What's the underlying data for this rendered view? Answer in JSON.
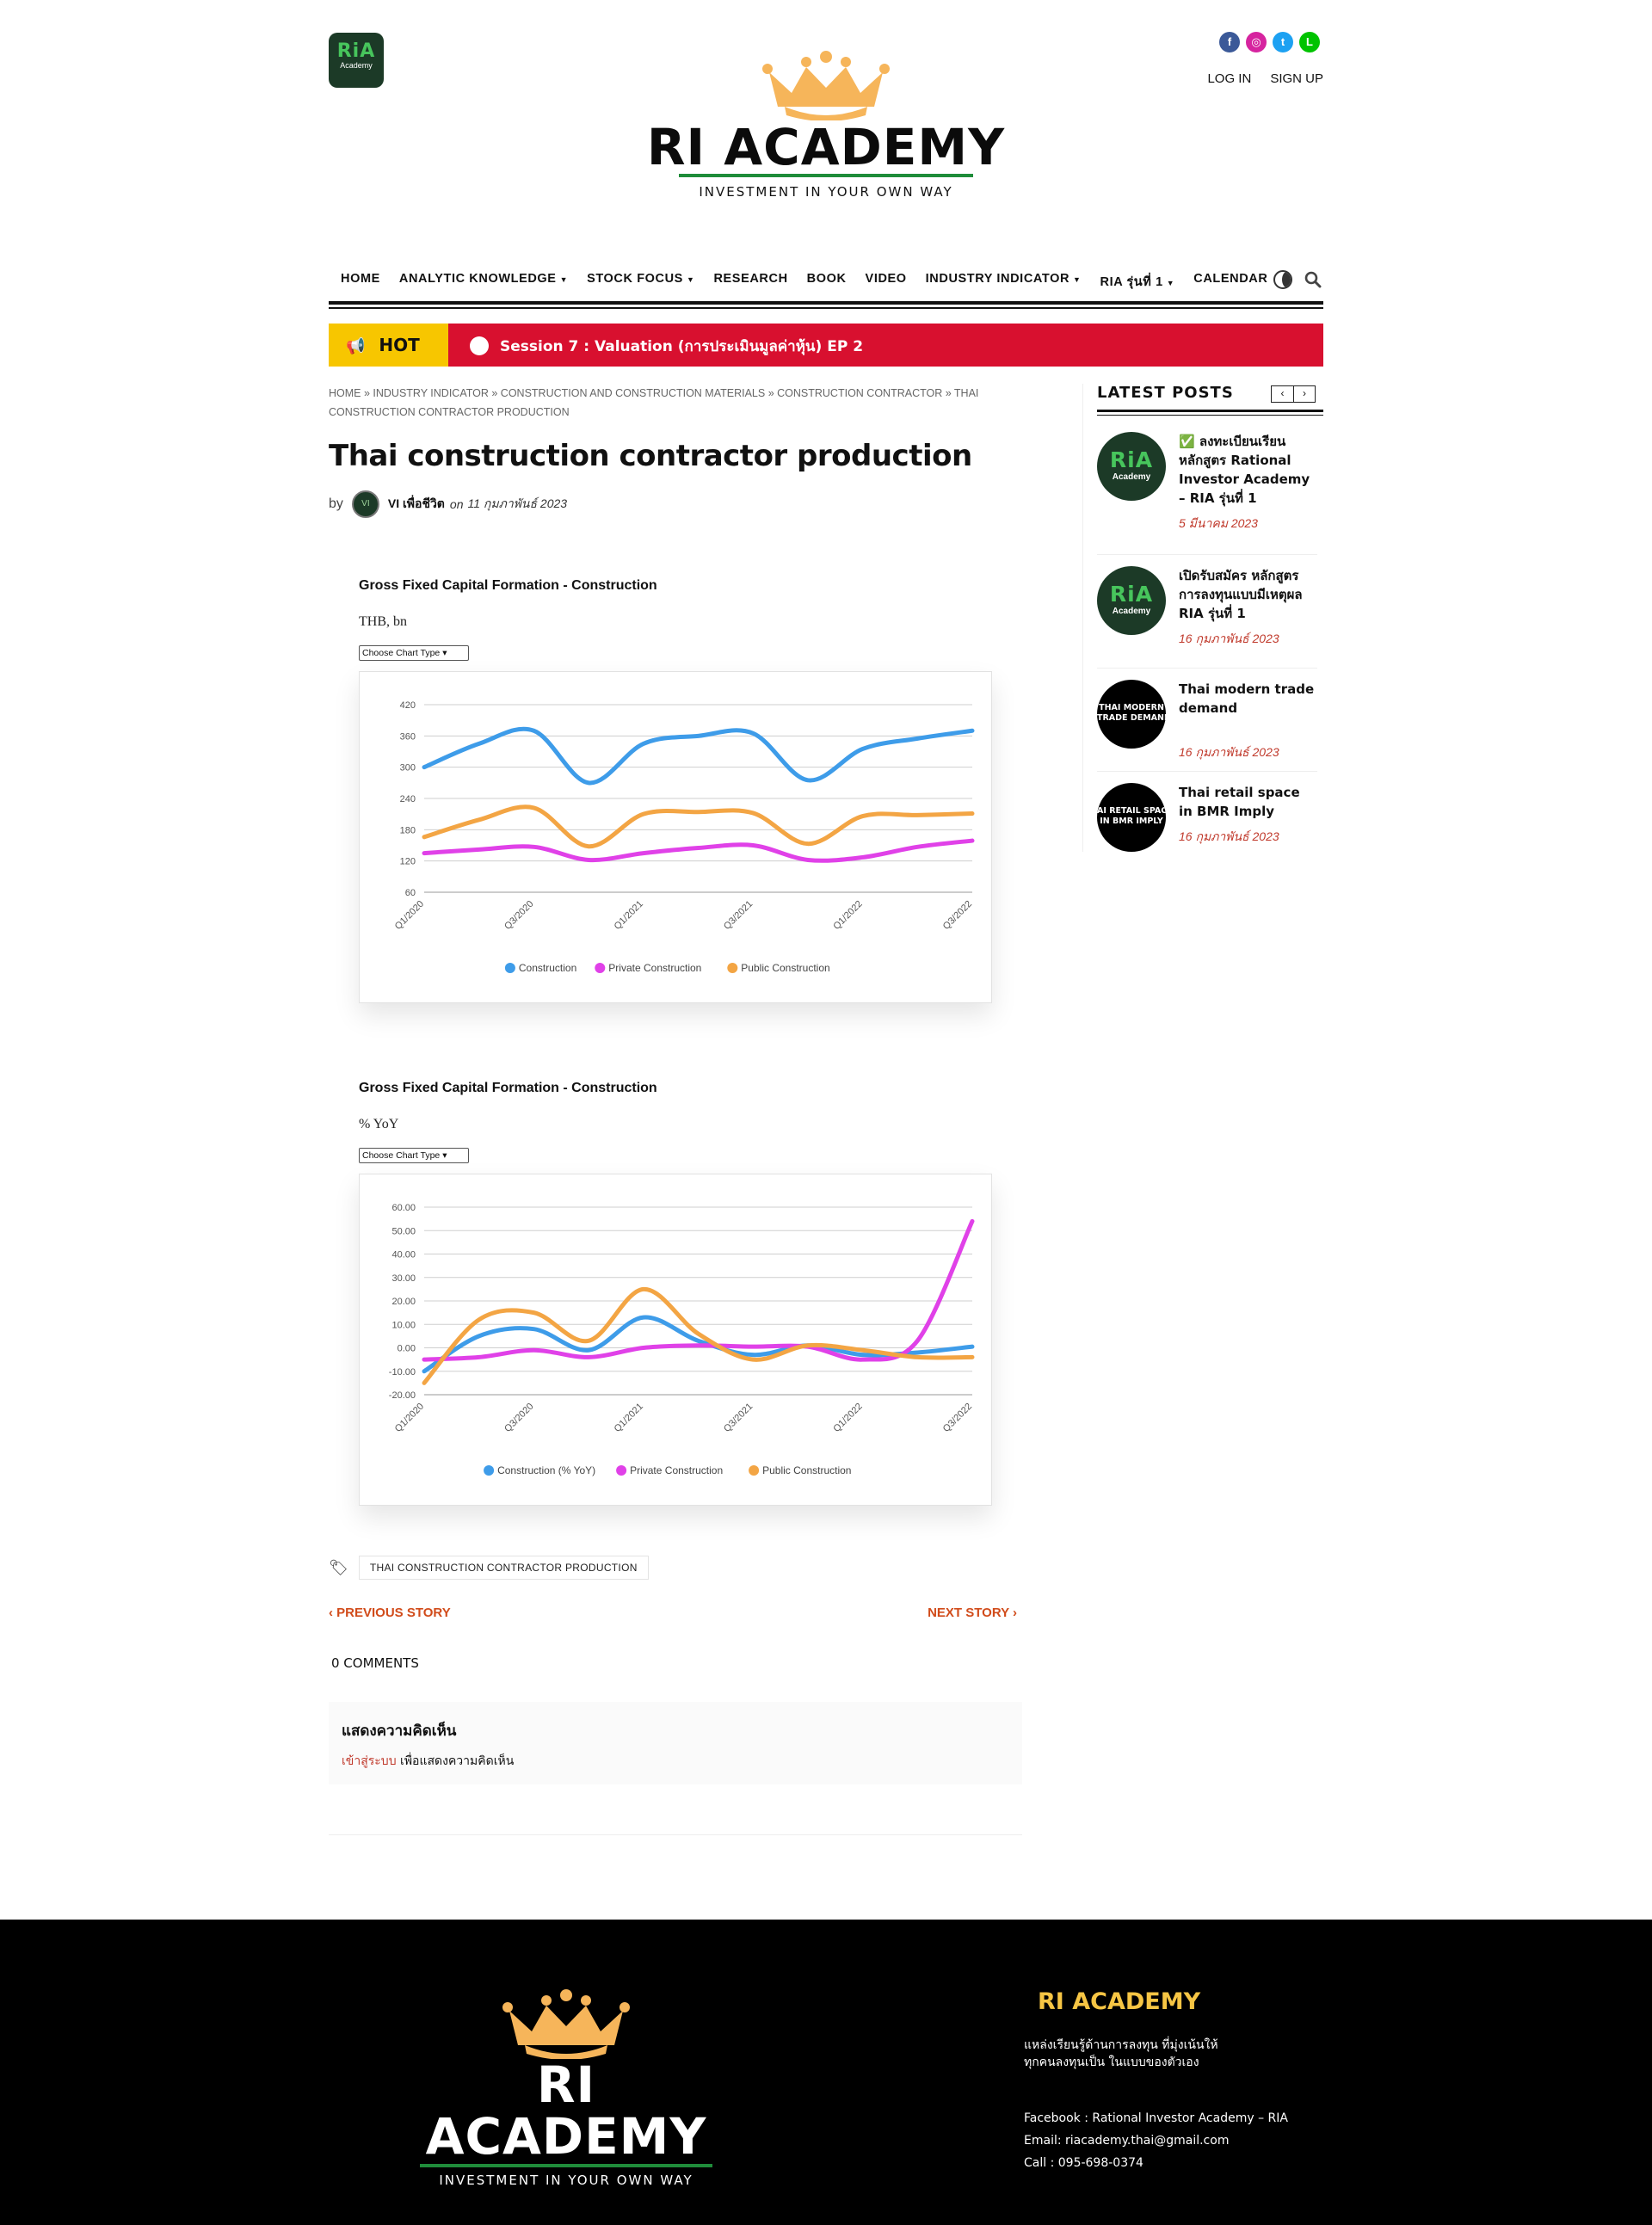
{
  "header": {
    "logo_badge": {
      "ria": "RiA",
      "academy": "Academy"
    },
    "brand_title": "RI ACADEMY",
    "brand_tagline": "INVESTMENT IN YOUR OWN WAY",
    "socials": [
      {
        "name": "facebook",
        "glyph": "f",
        "color": "#3b5998"
      },
      {
        "name": "instagram",
        "glyph": "◎",
        "color": "#d6249f"
      },
      {
        "name": "twitter",
        "glyph": "t",
        "color": "#1da1f2"
      },
      {
        "name": "line",
        "glyph": "L",
        "color": "#00c300"
      }
    ],
    "login": "LOG IN",
    "signup": "SIGN UP"
  },
  "nav": {
    "items": [
      {
        "label": "HOME",
        "dropdown": false
      },
      {
        "label": "ANALYTIC KNOWLEDGE",
        "dropdown": true
      },
      {
        "label": "STOCK FOCUS",
        "dropdown": true
      },
      {
        "label": "RESEARCH",
        "dropdown": false
      },
      {
        "label": "BOOK",
        "dropdown": false
      },
      {
        "label": "VIDEO",
        "dropdown": false
      },
      {
        "label": "INDUSTRY INDICATOR",
        "dropdown": true
      },
      {
        "label": "RIA รุ่นที่ 1",
        "dropdown": true
      },
      {
        "label": "CALENDAR",
        "dropdown": false
      }
    ],
    "icons": [
      "dark-mode-icon",
      "search-icon"
    ]
  },
  "hot": {
    "label": "HOT",
    "text": "Session 7 : Valuation (การประเมินมูลค่าหุ้น) EP 2"
  },
  "article": {
    "breadcrumb": "HOME » INDUSTRY INDICATOR » CONSTRUCTION AND CONSTRUCTION MATERIALS » CONSTRUCTION CONTRACTOR » THAI CONSTRUCTION CONTRACTOR PRODUCTION",
    "title": "Thai construction contractor production",
    "by": "by",
    "author": "VI เพื่อชีวิต",
    "on": "on",
    "date": "11 กุมภาพันธ์ 2023",
    "tag": "THAI CONSTRUCTION CONTRACTOR PRODUCTION",
    "prev_story": "PREVIOUS STORY",
    "next_story": "NEXT STORY",
    "comments_count": "0 COMMENTS",
    "comment_heading": "แสดงความคิดเห็น",
    "comment_login": "เข้าสู่ระบบ",
    "comment_rest": " เพื่อแสดงความคิดเห็น"
  },
  "charts": [
    {
      "heading": "Gross Fixed Capital Formation - Construction",
      "unit": "THB, bn",
      "select_label": "Choose Chart Type"
    },
    {
      "heading": "Gross Fixed Capital Formation - Construction",
      "unit": "% YoY",
      "select_label": "Choose Chart Type"
    }
  ],
  "chart_data": [
    {
      "type": "line",
      "ylim": [
        60,
        420
      ],
      "yticks": [
        60,
        120,
        180,
        240,
        300,
        360,
        420
      ],
      "ytick_labels": [
        "60",
        "120",
        "180",
        "240",
        "300",
        "360",
        "420"
      ],
      "x": [
        "Q1/2020",
        "Q2/2020",
        "Q3/2020",
        "Q4/2020",
        "Q1/2021",
        "Q2/2021",
        "Q3/2021",
        "Q4/2021",
        "Q1/2022",
        "Q2/2022",
        "Q3/2022"
      ],
      "xtick_labels": [
        "Q1/2020",
        "Q3/2020",
        "Q1/2021",
        "Q3/2021",
        "Q1/2022",
        "Q3/2022"
      ],
      "series": [
        {
          "name": "Construction",
          "color": "#3e9ce9",
          "values": [
            300,
            345,
            370,
            270,
            345,
            360,
            365,
            275,
            335,
            355,
            370
          ]
        },
        {
          "name": "Private Construction",
          "color": "#e041e8",
          "values": [
            135,
            142,
            147,
            122,
            135,
            145,
            150,
            122,
            127,
            147,
            159
          ]
        },
        {
          "name": "Public Construction",
          "color": "#f3a544",
          "values": [
            166,
            199,
            222,
            148,
            210,
            214,
            212,
            153,
            206,
            208,
            211
          ]
        }
      ],
      "grid": true,
      "legend": "bottom"
    },
    {
      "type": "line",
      "ylim": [
        -20,
        60
      ],
      "yticks": [
        -20,
        -10,
        0,
        10,
        20,
        30,
        40,
        50,
        60
      ],
      "ytick_labels": [
        "-20.00",
        "-10.00",
        "0.00",
        "10.00",
        "20.00",
        "30.00",
        "40.00",
        "50.00",
        "60.00"
      ],
      "x": [
        "Q1/2020",
        "Q2/2020",
        "Q3/2020",
        "Q4/2020",
        "Q1/2021",
        "Q2/2021",
        "Q3/2021",
        "Q4/2021",
        "Q1/2022",
        "Q2/2022",
        "Q3/2022"
      ],
      "xtick_labels": [
        "Q1/2020",
        "Q3/2020",
        "Q1/2021",
        "Q3/2021",
        "Q1/2022",
        "Q3/2022"
      ],
      "series": [
        {
          "name": "Construction (% YoY)",
          "color": "#3e9ce9",
          "values": [
            -10,
            5,
            8,
            -1,
            13,
            3,
            -3,
            1,
            -3,
            -2,
            0.5
          ]
        },
        {
          "name": "Private Construction",
          "color": "#e041e8",
          "values": [
            -5,
            -4,
            -1,
            -4,
            0,
            1,
            0.5,
            0.5,
            -5,
            3,
            54
          ]
        },
        {
          "name": "Public Construction",
          "color": "#f3a544",
          "values": [
            -15,
            12,
            15,
            3,
            25,
            6,
            -5,
            1,
            -1,
            -4,
            -4
          ]
        }
      ],
      "grid": true,
      "legend": "bottom"
    }
  ],
  "sidebar": {
    "title": "LATEST POSTS",
    "posts": [
      {
        "thumb": "green",
        "thumb_text": "RiA",
        "thumb_sub": "Academy",
        "title": "✅ ลงทะเบียนเรียน หลักสูตร Rational Investor Academy – RIA รุ่นที่ 1",
        "date": "5 มีนาคม 2023"
      },
      {
        "thumb": "green",
        "thumb_text": "RiA",
        "thumb_sub": "Academy",
        "title": "เปิดรับสมัคร หลักสูตร การลงทุนแบบมีเหตุผล RIA รุ่นที่ 1",
        "date": "16 กุมภาพันธ์ 2023"
      },
      {
        "thumb": "black",
        "thumb_text": "THAI MODERN",
        "thumb_sub": "TRADE DEMAND",
        "title": "Thai modern trade demand",
        "date": "16 กุมภาพันธ์ 2023"
      },
      {
        "thumb": "black",
        "thumb_text": "AI RETAIL SPAC",
        "thumb_sub": "IN BMR IMPLY",
        "title": "Thai retail space in BMR Imply",
        "date": "16 กุมภาพันธ์ 2023"
      }
    ]
  },
  "footer": {
    "brand_title": "RI ACADEMY",
    "brand_tagline": "INVESTMENT IN YOUR OWN WAY",
    "right_title": "RI ACADEMY",
    "desc_line1": "แหล่งเรียนรู้ด้านการลงทุน ที่มุ่งเน้นให้",
    "desc_line2": "ทุกคนลงทุนเป็น ในแบบของตัวเอง",
    "facebook": "Facebook : Rational Investor Academy – RIA",
    "email": "Email: riacademy.thai@gmail.com",
    "call": "Call : 095-698-0374"
  },
  "colors": {
    "hot_yellow": "#f7c600",
    "hot_red": "#d8102f",
    "accent_green": "#1f8c3a",
    "link_red": "#c0392b",
    "footer_gold": "#f6c544"
  }
}
